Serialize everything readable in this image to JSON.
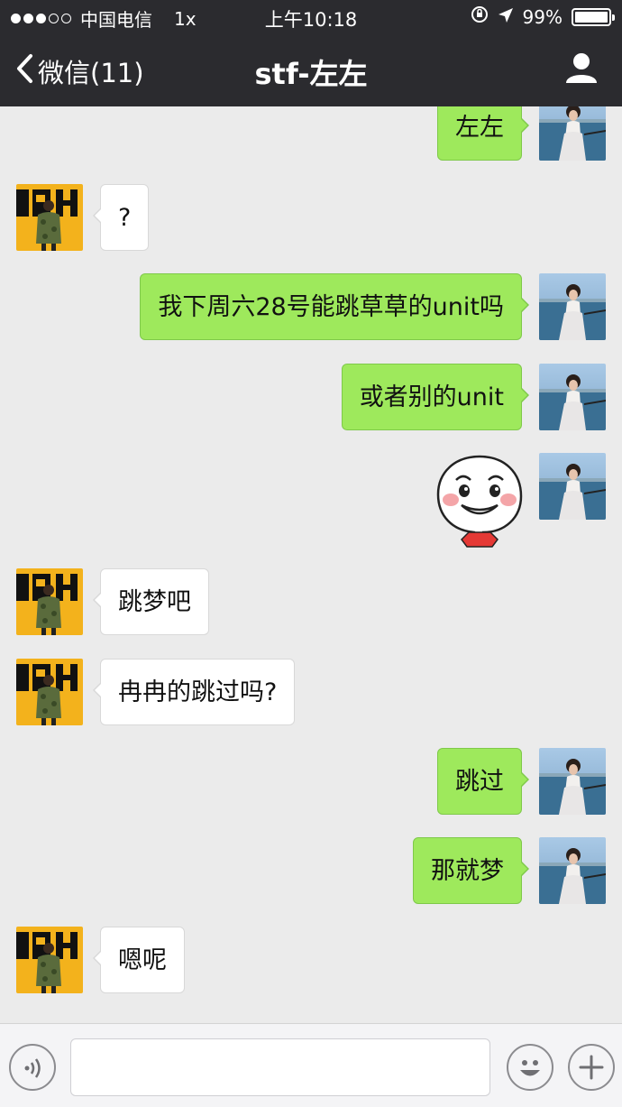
{
  "status_bar": {
    "carrier": "中国电信",
    "speed": "1x",
    "time": "上午10:18",
    "battery_percent": "99%",
    "battery_level": 0.99
  },
  "nav": {
    "back_label": "微信(11)",
    "title": "stf-左左"
  },
  "colors": {
    "header_bg": "#2b2b2f",
    "outgoing_bubble": "#9ee95c",
    "incoming_bubble": "#ffffff",
    "chat_bg": "#ebebeb"
  },
  "messages": [
    {
      "side": "out",
      "text": "左左"
    },
    {
      "side": "in",
      "text": "?"
    },
    {
      "side": "out",
      "text": "我下周六28号能跳草草的unit吗"
    },
    {
      "side": "out",
      "text": "或者别的unit"
    },
    {
      "side": "out",
      "type": "sticker",
      "sticker": "grinning-face-sticker"
    },
    {
      "side": "in",
      "text": "跳梦吧"
    },
    {
      "side": "in",
      "text": "冉冉的跳过吗?"
    },
    {
      "side": "out",
      "text": "跳过"
    },
    {
      "side": "out",
      "text": "那就梦"
    },
    {
      "side": "in",
      "text": "嗯呢"
    }
  ],
  "input_bar": {
    "voice_icon": "voice-icon",
    "emoji_icon": "emoji-icon",
    "add_icon": "plus-icon",
    "value": ""
  }
}
